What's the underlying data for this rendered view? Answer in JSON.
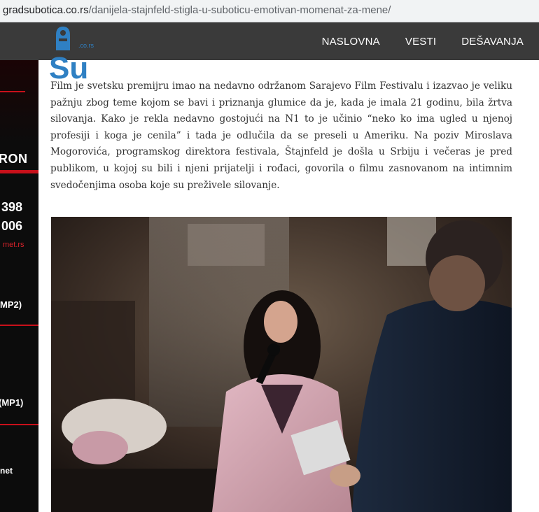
{
  "browser": {
    "url_host": "gradsubotica.co.rs",
    "url_path": "/danijela-stajnfeld-stigla-u-suboticu-emotivan-momenat-za-mene/"
  },
  "header": {
    "logo_text": "Su",
    "logo_tld": ".co.rs",
    "nav": [
      "NASLOVNA",
      "VESTI",
      "DEŠAVANJA"
    ]
  },
  "sidebar_ad": {
    "brand_fragment": "RON",
    "phone_1": "398",
    "phone_2": "006",
    "link_fragment": "met.rs",
    "label_mp2": "MP2)",
    "label_mp1": "(MP1)",
    "footer_fragment": "net"
  },
  "article": {
    "paragraph": "Film je svetsku premijru imao na nedavno održanom Sarajevo Film Festivalu i izazvao je veliku pažnju zbog teme kojom se bavi i priznanja glumice da je, kada je imala 21 godinu, bila žrtva silovanja. Kako je rekla nedavno gostojući na N1 to je učinio “neko ko ima ugled u njenoj profesiji i koga je cenila” i tada je odlučila da se preseli u Ameriku. Na poziv Miroslava Mogorovića, programskog direktora festivala, Štajnfeld je došla u Srbiju i večeras je pred publikom, u kojoj su bili i njeni prijatelji i rođaci, govorila o filmu zasnovanom na intimnim svedočenjima osoba koje su preživele silovanje.",
    "photo_icon": "event-photo"
  },
  "colors": {
    "header_bg": "#3a3a3a",
    "logo_blue": "#2f80c3",
    "sidebar_bg": "#0c0c0c",
    "sidebar_red": "#c8101a",
    "text": "#333333"
  }
}
